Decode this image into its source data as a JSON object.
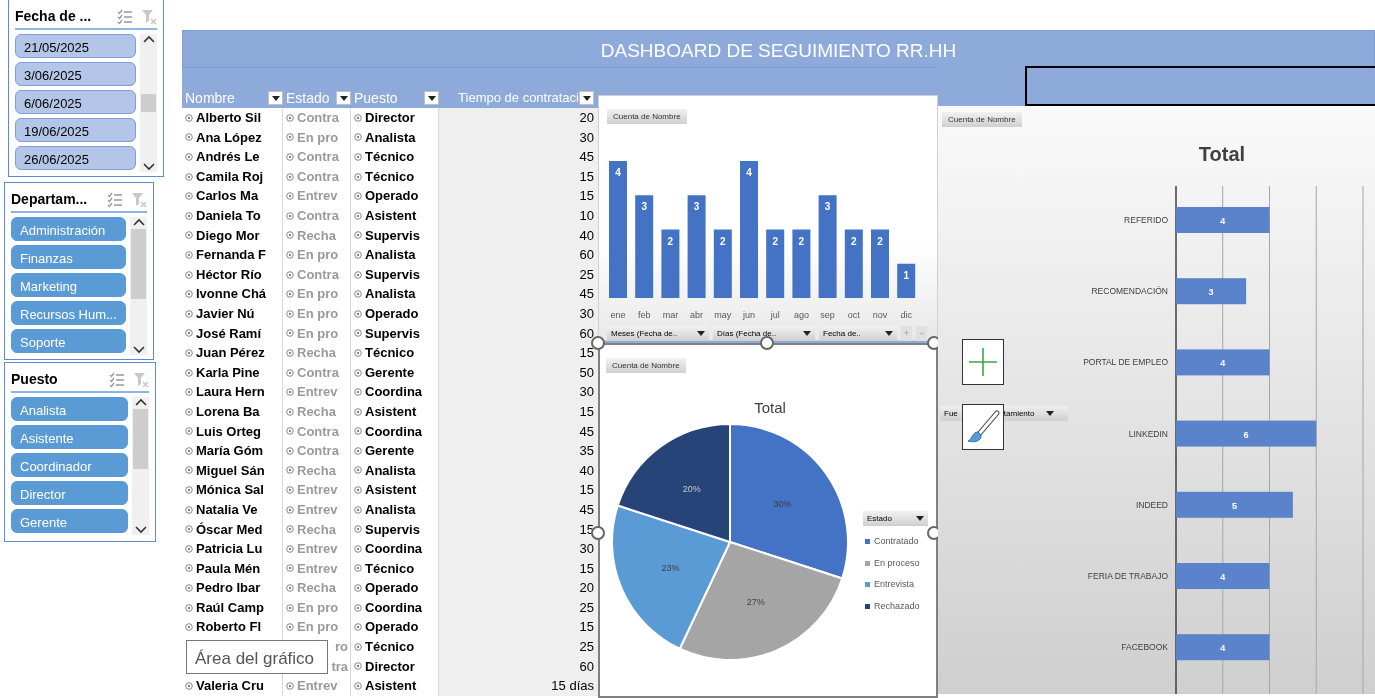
{
  "slicers": [
    {
      "title": "Fecha de ...",
      "items": [
        {
          "label": "21/05/2025",
          "selected": false
        },
        {
          "label": "3/06/2025",
          "selected": false
        },
        {
          "label": "6/06/2025",
          "selected": false
        },
        {
          "label": "19/06/2025",
          "selected": false
        },
        {
          "label": "26/06/2025",
          "selected": false
        }
      ]
    },
    {
      "title": "Departam...",
      "items": [
        {
          "label": "Administración",
          "selected": true
        },
        {
          "label": "Finanzas",
          "selected": true
        },
        {
          "label": "Marketing",
          "selected": true
        },
        {
          "label": "Recursos Hum...",
          "selected": true
        },
        {
          "label": "Soporte",
          "selected": true
        }
      ]
    },
    {
      "title": "Puesto",
      "items": [
        {
          "label": "Analista",
          "selected": true
        },
        {
          "label": "Asistente",
          "selected": true
        },
        {
          "label": "Coordinador",
          "selected": true
        },
        {
          "label": "Director",
          "selected": true
        },
        {
          "label": "Gerente",
          "selected": true
        }
      ]
    }
  ],
  "header": {
    "title": "DASHBOARD DE SEGUIMIENTO RR.HH"
  },
  "table": {
    "columns": [
      "Nombre",
      "Estado",
      "Puesto",
      "Tiempo de contrataci"
    ],
    "rows": [
      {
        "nombre": "Alberto Sil",
        "estado": "Contra",
        "puesto": "Director",
        "tiempo": "20"
      },
      {
        "nombre": "Ana López",
        "estado": "En pro",
        "puesto": "Analista",
        "tiempo": "30"
      },
      {
        "nombre": "Andrés Le",
        "estado": "Contra",
        "puesto": "Técnico",
        "tiempo": "45"
      },
      {
        "nombre": "Camila Roj",
        "estado": "Contra",
        "puesto": "Técnico",
        "tiempo": "15"
      },
      {
        "nombre": "Carlos Ma",
        "estado": "Entrev",
        "puesto": "Operado",
        "tiempo": "15"
      },
      {
        "nombre": "Daniela To",
        "estado": "Contra",
        "puesto": "Asistent",
        "tiempo": "10"
      },
      {
        "nombre": "Diego Mor",
        "estado": "Recha",
        "puesto": "Supervis",
        "tiempo": "40"
      },
      {
        "nombre": "Fernanda F",
        "estado": "En pro",
        "puesto": "Analista",
        "tiempo": "60"
      },
      {
        "nombre": "Héctor Río",
        "estado": "Contra",
        "puesto": "Supervis",
        "tiempo": "25"
      },
      {
        "nombre": "Ivonne Chá",
        "estado": "En pro",
        "puesto": "Analista",
        "tiempo": "45"
      },
      {
        "nombre": "Javier Nú",
        "estado": "En pro",
        "puesto": "Operado",
        "tiempo": "30"
      },
      {
        "nombre": "José Ramí",
        "estado": "En pro",
        "puesto": "Supervis",
        "tiempo": "60"
      },
      {
        "nombre": "Juan Pérez",
        "estado": "Recha",
        "puesto": "Técnico",
        "tiempo": "15"
      },
      {
        "nombre": "Karla Pine",
        "estado": "Contra",
        "puesto": "Gerente",
        "tiempo": "50"
      },
      {
        "nombre": "Laura Hern",
        "estado": "Entrev",
        "puesto": "Coordina",
        "tiempo": "30"
      },
      {
        "nombre": "Lorena Ba",
        "estado": "Recha",
        "puesto": "Asistent",
        "tiempo": "15"
      },
      {
        "nombre": "Luis Orteg",
        "estado": "Contra",
        "puesto": "Coordina",
        "tiempo": "45"
      },
      {
        "nombre": "María Góm",
        "estado": "Contra",
        "puesto": "Gerente",
        "tiempo": "35"
      },
      {
        "nombre": "Miguel Sán",
        "estado": "Recha",
        "puesto": "Analista",
        "tiempo": "40"
      },
      {
        "nombre": "Mónica Sal",
        "estado": "Entrev",
        "puesto": "Asistent",
        "tiempo": "15"
      },
      {
        "nombre": "Natalia Ve",
        "estado": "Entrev",
        "puesto": "Analista",
        "tiempo": "45"
      },
      {
        "nombre": "Óscar Med",
        "estado": "Recha",
        "puesto": "Supervis",
        "tiempo": "15"
      },
      {
        "nombre": "Patricia Lu",
        "estado": "Entrev",
        "puesto": "Coordina",
        "tiempo": "30"
      },
      {
        "nombre": "Paula Mén",
        "estado": "Entrev",
        "puesto": "Técnico",
        "tiempo": "15"
      },
      {
        "nombre": "Pedro Ibar",
        "estado": "Recha",
        "puesto": "Operado",
        "tiempo": "20"
      },
      {
        "nombre": "Raúl Camp",
        "estado": "En pro",
        "puesto": "Coordina",
        "tiempo": "25"
      },
      {
        "nombre": "Roberto Fl",
        "estado": "En pro",
        "puesto": "Operado",
        "tiempo": "15"
      },
      {
        "estado": "ro",
        "puesto": "Técnico",
        "tiempo": "25"
      },
      {
        "estado": "tra",
        "puesto": "Director",
        "tiempo": "60"
      },
      {
        "nombre": "Valeria Cru",
        "estado": "Entrev",
        "puesto": "Asistent",
        "tiempo": "15 días"
      }
    ]
  },
  "tooltip": "Área del gráfico",
  "month_chart": {
    "field_button": "Cuenta de Nombre",
    "chart_data": {
      "type": "bar",
      "categories": [
        "ene",
        "feb",
        "mar",
        "abr",
        "may",
        "jun",
        "jul",
        "ago",
        "sep",
        "oct",
        "nov",
        "dic"
      ],
      "values": [
        4,
        3,
        2,
        3,
        2,
        4,
        2,
        2,
        3,
        2,
        2,
        1
      ],
      "data_labels": true
    },
    "axis_buttons": [
      "Meses (Fecha de..",
      "Días (Fecha de..",
      "Fecha de.."
    ],
    "zoom_buttons": [
      "+",
      "−"
    ]
  },
  "status_chart": {
    "field_button": "Cuenta de Nombre",
    "chart_data": {
      "type": "pie",
      "title": "Total",
      "categories": [
        "Contratado",
        "En proceso",
        "Entrevista",
        "Rechazado"
      ],
      "values": [
        30,
        27,
        23,
        20
      ],
      "colors": [
        "#4472c4",
        "#a5a5a5",
        "#5b9bd5",
        "#264478"
      ],
      "value_labels": [
        "30%",
        "27%",
        "23%",
        "20%"
      ],
      "legend": {
        "title": "Estado"
      }
    }
  },
  "source_chart": {
    "field_button": "Cuenta de Nombre",
    "filter_button": {
      "label_start": "Fue",
      "label_end": "tamiento"
    },
    "chart_data": {
      "type": "bar",
      "orientation": "horizontal",
      "title": "Total",
      "categories": [
        "REFERIDO",
        "RECOMENDACIÓN",
        "PORTAL DE EMPLEO",
        "LINKEDIN",
        "INDEED",
        "FERIA DE TRABAJO",
        "FACEBOOK"
      ],
      "values": [
        4,
        3,
        4,
        6,
        5,
        4,
        4
      ],
      "xlim": [
        0,
        8
      ],
      "data_labels": true
    }
  }
}
